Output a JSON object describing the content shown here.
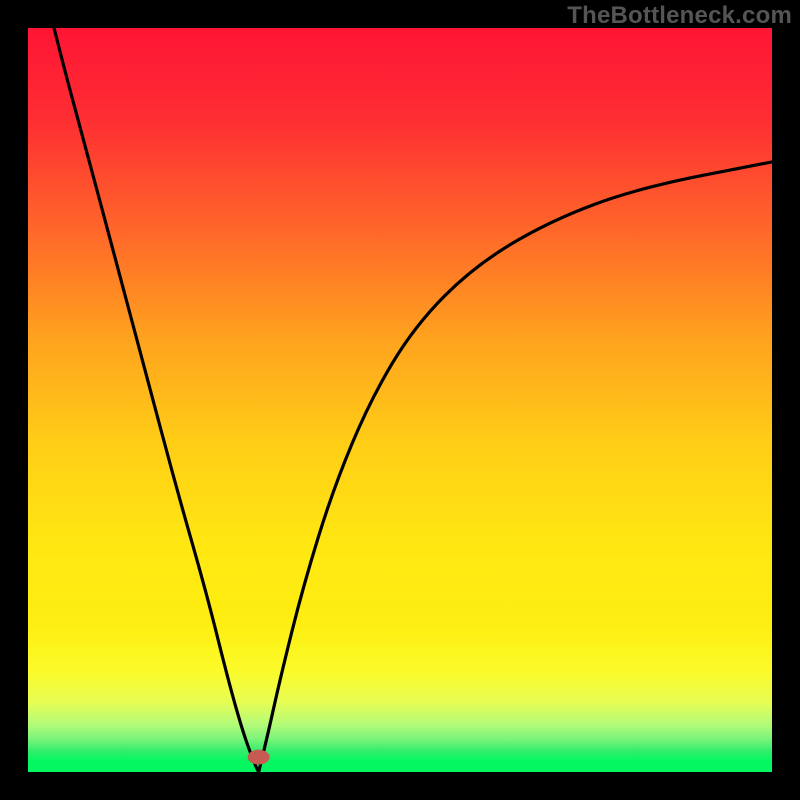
{
  "watermark": "TheBottleneck.com",
  "chart_data": {
    "type": "line",
    "title": "",
    "xlabel": "",
    "ylabel": "",
    "xlim": [
      0,
      100
    ],
    "ylim": [
      0,
      100
    ],
    "background_gradient": {
      "top": "#fe1835",
      "mid_upper": "#ffa31e",
      "mid": "#ffe812",
      "mid_lower": "#fcfb27",
      "green": "#00e756",
      "bottom_band": "#04f760"
    },
    "minimum_point": {
      "x": 31,
      "y": 0
    },
    "marker": {
      "x": 31,
      "y": 2,
      "color": "#c85a54"
    },
    "gradient_bands": [
      {
        "y": 16,
        "color": "#fe1835"
      },
      {
        "y": 43,
        "color": "#ff7c24"
      },
      {
        "y": 62,
        "color": "#ffcf16"
      },
      {
        "y": 78,
        "color": "#ffee12"
      },
      {
        "y": 89,
        "color": "#f2f94b"
      },
      {
        "y": 94,
        "color": "#c3fa6e"
      },
      {
        "y": 97,
        "color": "#60ee6e"
      },
      {
        "y": 100,
        "color": "#04f760"
      }
    ],
    "series": [
      {
        "name": "left-branch",
        "x": [
          3.5,
          5,
          8,
          12,
          16,
          20,
          24,
          27,
          29,
          30.5,
          31
        ],
        "y": [
          100,
          94,
          83,
          68,
          53,
          38,
          24,
          12,
          5,
          1,
          0
        ]
      },
      {
        "name": "right-branch",
        "x": [
          31,
          32,
          34,
          37,
          41,
          46,
          52,
          60,
          70,
          82,
          100
        ],
        "y": [
          0,
          4,
          13,
          25,
          38,
          50,
          60,
          68,
          74,
          78.5,
          82
        ]
      }
    ]
  }
}
